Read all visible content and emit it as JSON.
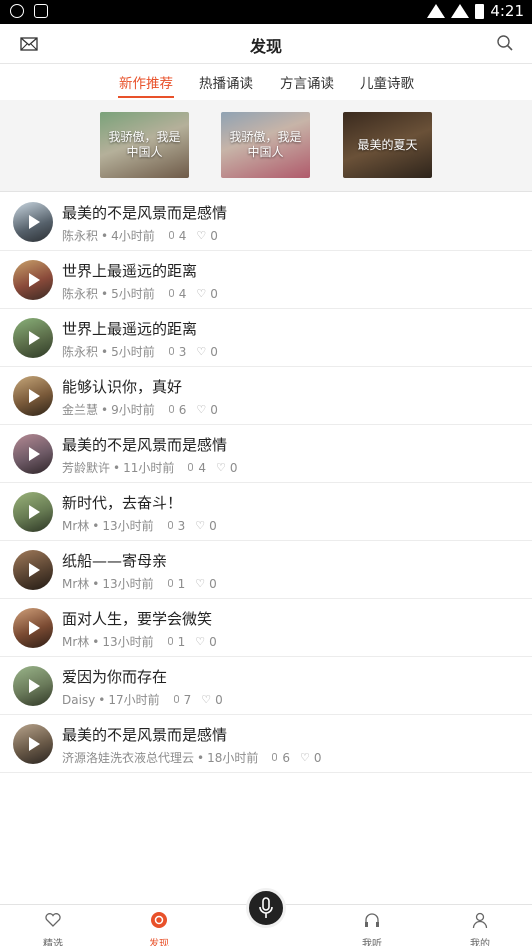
{
  "status_bar": {
    "time": "4:21"
  },
  "header": {
    "title": "发现",
    "left_icon": "mail-icon",
    "right_icon": "search-icon"
  },
  "tabs": [
    {
      "label": "新作推荐",
      "active": true
    },
    {
      "label": "热播诵读",
      "active": false
    },
    {
      "label": "方言诵读",
      "active": false
    },
    {
      "label": "儿童诗歌",
      "active": false
    }
  ],
  "banner": [
    {
      "text": "我骄傲，我是中国人"
    },
    {
      "text": "我骄傲，我是中国人"
    },
    {
      "text": "最美的夏天"
    }
  ],
  "items": [
    {
      "title": "最美的不是风景而是感情",
      "author": "陈永积",
      "time": "4小时前",
      "plays": "4",
      "likes": "0"
    },
    {
      "title": "世界上最遥远的距离",
      "author": "陈永积",
      "time": "5小时前",
      "plays": "4",
      "likes": "0"
    },
    {
      "title": "世界上最遥远的距离",
      "author": "陈永积",
      "time": "5小时前",
      "plays": "3",
      "likes": "0"
    },
    {
      "title": "能够认识你，真好",
      "author": "金兰慧",
      "time": "9小时前",
      "plays": "6",
      "likes": "0"
    },
    {
      "title": "最美的不是风景而是感情",
      "author": "芳龄默许",
      "time": "11小时前",
      "plays": "4",
      "likes": "0"
    },
    {
      "title": "新时代，去奋斗！",
      "author": "Mr林",
      "time": "13小时前",
      "plays": "3",
      "likes": "0"
    },
    {
      "title": "纸船——寄母亲",
      "author": "Mr林",
      "time": "13小时前",
      "plays": "1",
      "likes": "0"
    },
    {
      "title": "面对人生，要学会微笑",
      "author": "Mr林",
      "time": "13小时前",
      "plays": "1",
      "likes": "0"
    },
    {
      "title": "爱因为你而存在",
      "author": "Daisy",
      "time": "17小时前",
      "plays": "7",
      "likes": "0"
    },
    {
      "title": "最美的不是风景而是感情",
      "author": "济源洛娃洗衣液总代理云",
      "time": "18小时前",
      "plays": "6",
      "likes": "0"
    }
  ],
  "bottom_nav": [
    {
      "label": "精选",
      "icon": "heart-icon",
      "active": false
    },
    {
      "label": "发现",
      "icon": "discover-icon",
      "active": true
    },
    {
      "label": "我听",
      "icon": "headphones-icon",
      "active": false
    },
    {
      "label": "我的",
      "icon": "user-icon",
      "active": false
    }
  ],
  "colors": {
    "accent": "#e8512a",
    "text": "#222222",
    "meta": "#8c8c8c"
  }
}
